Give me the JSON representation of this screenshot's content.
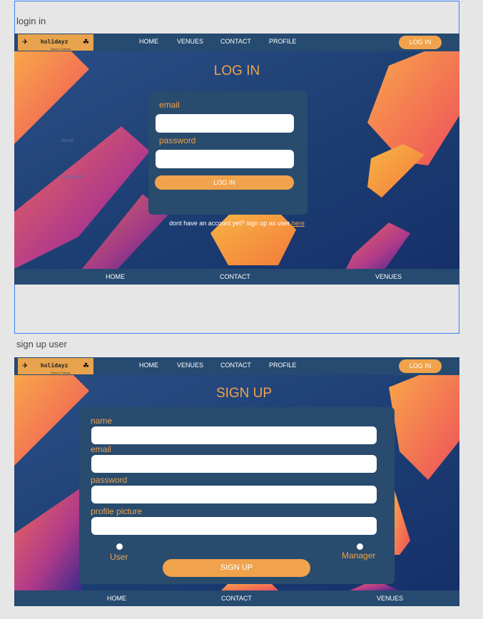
{
  "artboards": {
    "login_label": "login in",
    "signup_label": "sign up user"
  },
  "brand": {
    "name": "holidayz",
    "tagline": "Tours & Travels"
  },
  "nav": {
    "home": "HOME",
    "venues": "VENUES",
    "contact": "CONTACT",
    "profile": "PROFILE",
    "login_button": "LOG IN"
  },
  "login_page": {
    "title": "LOG IN",
    "email_label": "email",
    "password_label": "password",
    "submit_label": "LOG IN",
    "signup_prompt": "dont have an account yet? sign up as user",
    "signup_link": "here",
    "ghost_email": "email",
    "ghost_password": "password"
  },
  "signup_page": {
    "title": "SIGN UP",
    "name_label": "name",
    "email_label": "email",
    "password_label": "password",
    "picture_label": "profile picture",
    "role_user": "User",
    "role_manager": "Manager",
    "submit_label": "SIGN UP"
  },
  "footer": {
    "home": "HOME",
    "contact": "CONTACT",
    "venues": "VENUES"
  },
  "colors": {
    "accent": "#f0a34c",
    "nav": "#264a70",
    "panel": "#284b6e",
    "background": "#1b3a6b"
  }
}
